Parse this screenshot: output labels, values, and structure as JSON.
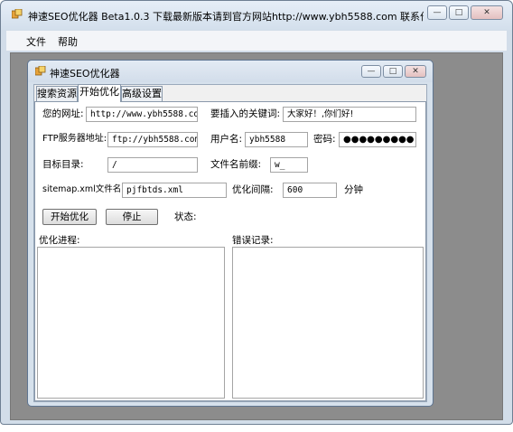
{
  "outer_window": {
    "title": "神速SEO优化器  Beta1.0.3 下载最新版本请到官方网站http://www.ybh5588.com 联系作者：soft6...",
    "buttons": {
      "minimize": "—",
      "maximize": "□",
      "close": "✕"
    }
  },
  "menu": {
    "items": [
      "文件",
      "帮助"
    ]
  },
  "inner_window": {
    "title": "神速SEO优化器",
    "buttons": {
      "minimize": "—",
      "maximize": "□",
      "close": "✕"
    }
  },
  "tabs": [
    "搜索资源",
    "开始优化",
    "高级设置"
  ],
  "active_tab": "开始优化",
  "form": {
    "url_label": "您的网址:",
    "url_value": "http://www.ybh5588.com/",
    "keyword_label": "要插入的关键词:",
    "keyword_value": "大家好！,你们好!",
    "ftp_label": "FTP服务器地址:",
    "ftp_value": "ftp://ybh5588.com/",
    "user_label": "用户名:",
    "user_value": "ybh5588",
    "password_label": "密码:",
    "password_value": "●●●●●●●●●",
    "dir_label": "目标目录:",
    "dir_value": "/",
    "prefix_label": "文件名前缀:",
    "prefix_value": "w_",
    "sitemap_label": "sitemap.xml文件名:",
    "sitemap_value": "pjfbtds.xml",
    "interval_label": "优化间隔:",
    "interval_value": "600",
    "interval_unit": "分钟"
  },
  "actions": {
    "start": "开始优化",
    "stop": "停止",
    "status_label": "状态:"
  },
  "panels": {
    "progress_label": "优化进程:",
    "errors_label": "错误记录:"
  }
}
